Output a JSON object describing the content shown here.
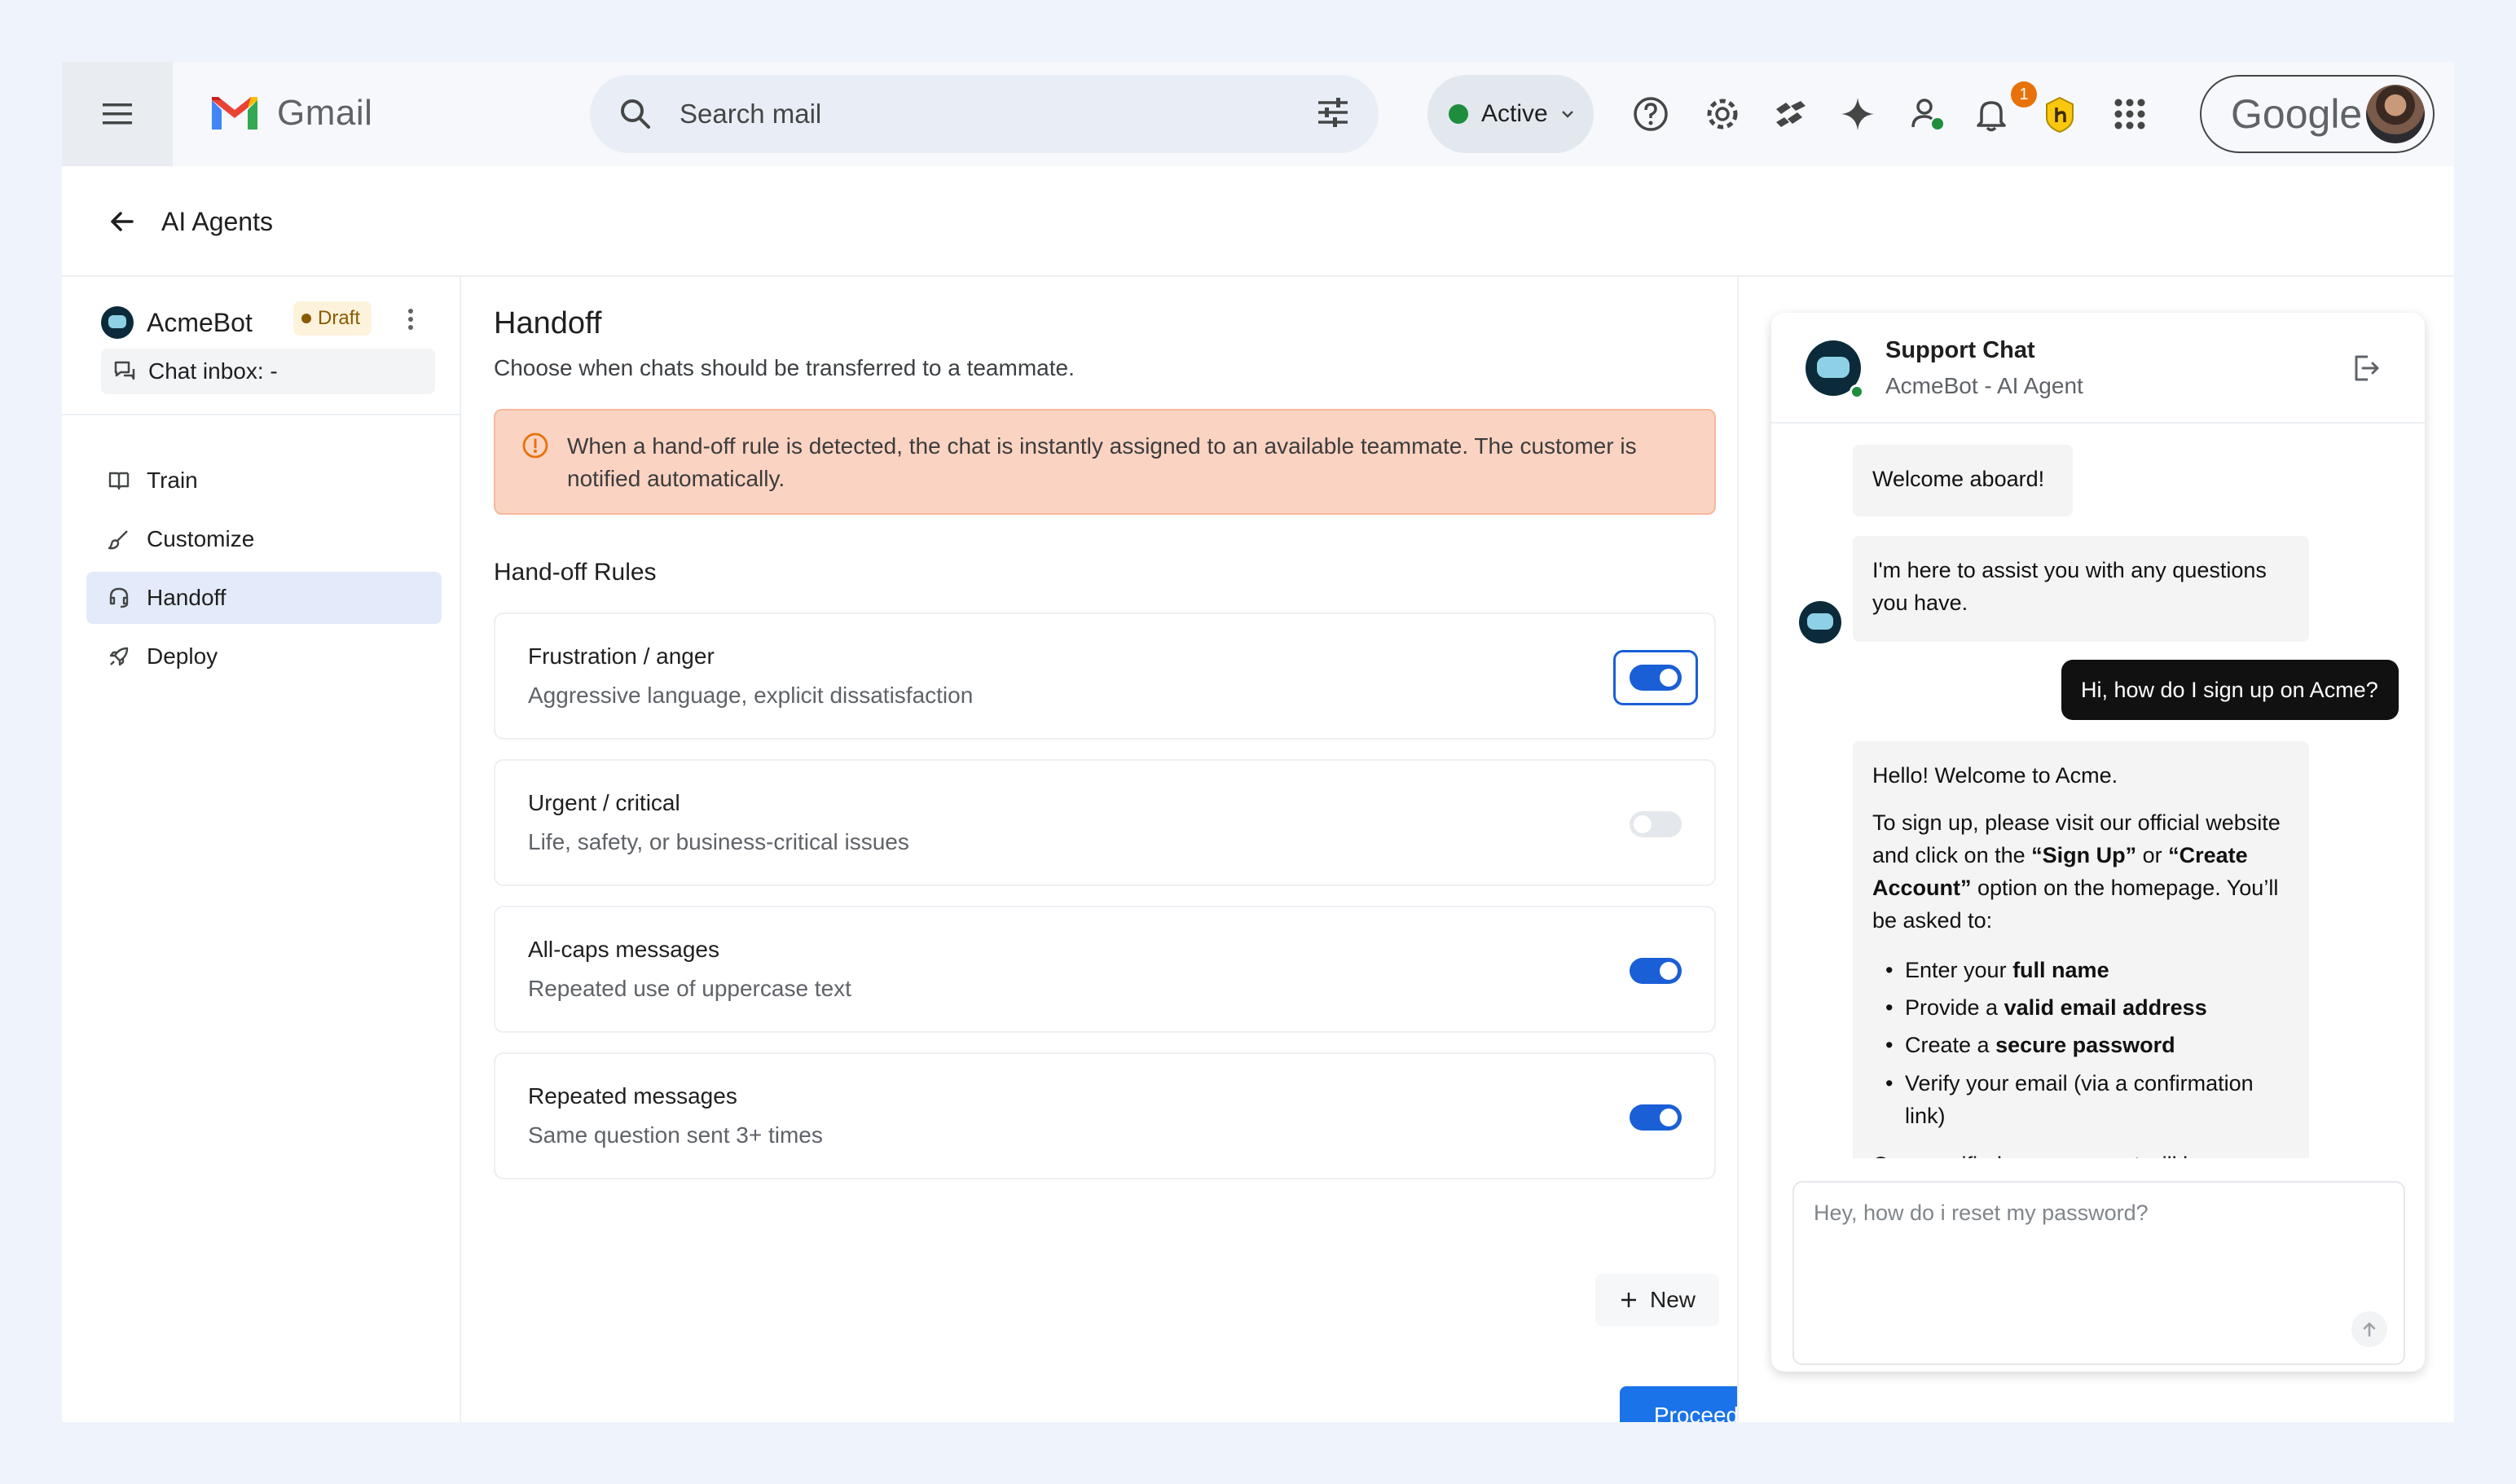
{
  "topbar": {
    "app_name": "Gmail",
    "search_placeholder": "Search mail",
    "status_label": "Active",
    "notification_count": "1",
    "account_label": "Google"
  },
  "header": {
    "title": "AI Agents"
  },
  "sidebar": {
    "bot_name": "AcmeBot",
    "badge": "Draft",
    "inbox_label": "Chat inbox: -",
    "items": [
      {
        "label": "Train",
        "icon": "book-icon"
      },
      {
        "label": "Customize",
        "icon": "brush-icon"
      },
      {
        "label": "Handoff",
        "icon": "headset-icon",
        "active": true
      },
      {
        "label": "Deploy",
        "icon": "rocket-icon"
      }
    ]
  },
  "main": {
    "title": "Handoff",
    "subtitle": "Choose when chats should be transferred to a teammate.",
    "alert_text": "When a hand-off rule is detected, the chat is instantly assigned to an available teammate. The customer is notified automatically.",
    "rules_title": "Hand-off Rules",
    "rules": [
      {
        "title": "Frustration / anger",
        "desc": "Aggressive language, explicit dissatisfaction",
        "enabled": true
      },
      {
        "title": "Urgent / critical",
        "desc": "Life, safety, or business-critical issues",
        "enabled": false
      },
      {
        "title": "All-caps messages",
        "desc": "Repeated use of uppercase text",
        "enabled": true
      },
      {
        "title": "Repeated messages",
        "desc": "Same question sent 3+ times",
        "enabled": true
      }
    ],
    "new_label": "New",
    "proceed_label": "Proceed"
  },
  "chat": {
    "title": "Support Chat",
    "subtitle": "AcmeBot - AI Agent",
    "messages": {
      "m1": "Welcome aboard!",
      "m2": "I'm here to assist you with any questions you have.",
      "user": "Hi, how do I sign up on Acme?",
      "reply_intro": "Hello! Welcome to Acme.",
      "reply_p2_a": "To sign up, please visit our official website and click on the ",
      "reply_p2_b": "“Sign Up”",
      "reply_p2_c": " or ",
      "reply_p2_d": "“Create Account”",
      "reply_p2_e": " option on the homepage. You’ll be asked to:",
      "bullets": [
        {
          "pre": "Enter your ",
          "bold": "full name",
          "post": ""
        },
        {
          "pre": "Provide a ",
          "bold": "valid email address",
          "post": ""
        },
        {
          "pre": "Create a ",
          "bold": "secure password",
          "post": ""
        },
        {
          "pre": "Verify your email (via a confirmation link)",
          "bold": "",
          "post": ""
        }
      ],
      "reply_tail": "Once verified, your account will be"
    },
    "composer_placeholder": "Hey, how do i reset my password?"
  },
  "colors": {
    "accent": "#1a73e8",
    "toggle_on": "#1a5fd6",
    "alert_bg": "#fbd3c2",
    "active_nav": "#e3ebfa",
    "online": "#1e8e3e"
  }
}
